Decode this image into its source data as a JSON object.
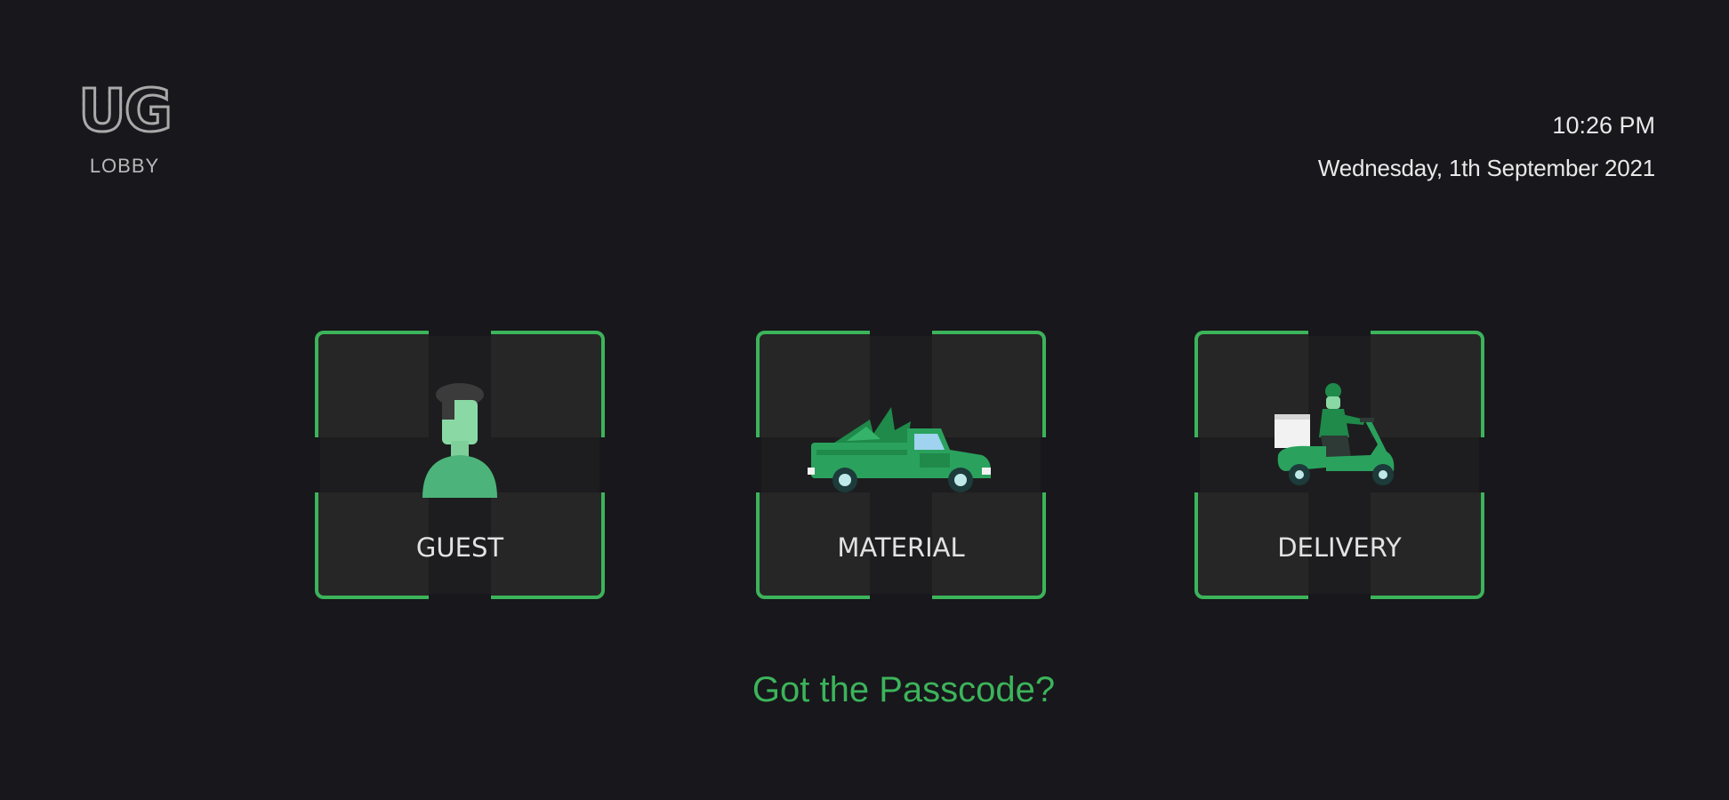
{
  "header": {
    "logo_text": "UG",
    "logo_subtitle": "LOBBY",
    "time": "10:26 PM",
    "date": "Wednesday, 1th September 2021"
  },
  "options": [
    {
      "label": "GUEST",
      "icon": "person-icon"
    },
    {
      "label": "MATERIAL",
      "icon": "truck-icon"
    },
    {
      "label": "DELIVERY",
      "icon": "scooter-icon"
    }
  ],
  "passcode_link": "Got the Passcode?",
  "colors": {
    "background": "#17171c",
    "card": "#262626",
    "accent": "#3cb45a",
    "icon_green": "#2a9d5c"
  }
}
